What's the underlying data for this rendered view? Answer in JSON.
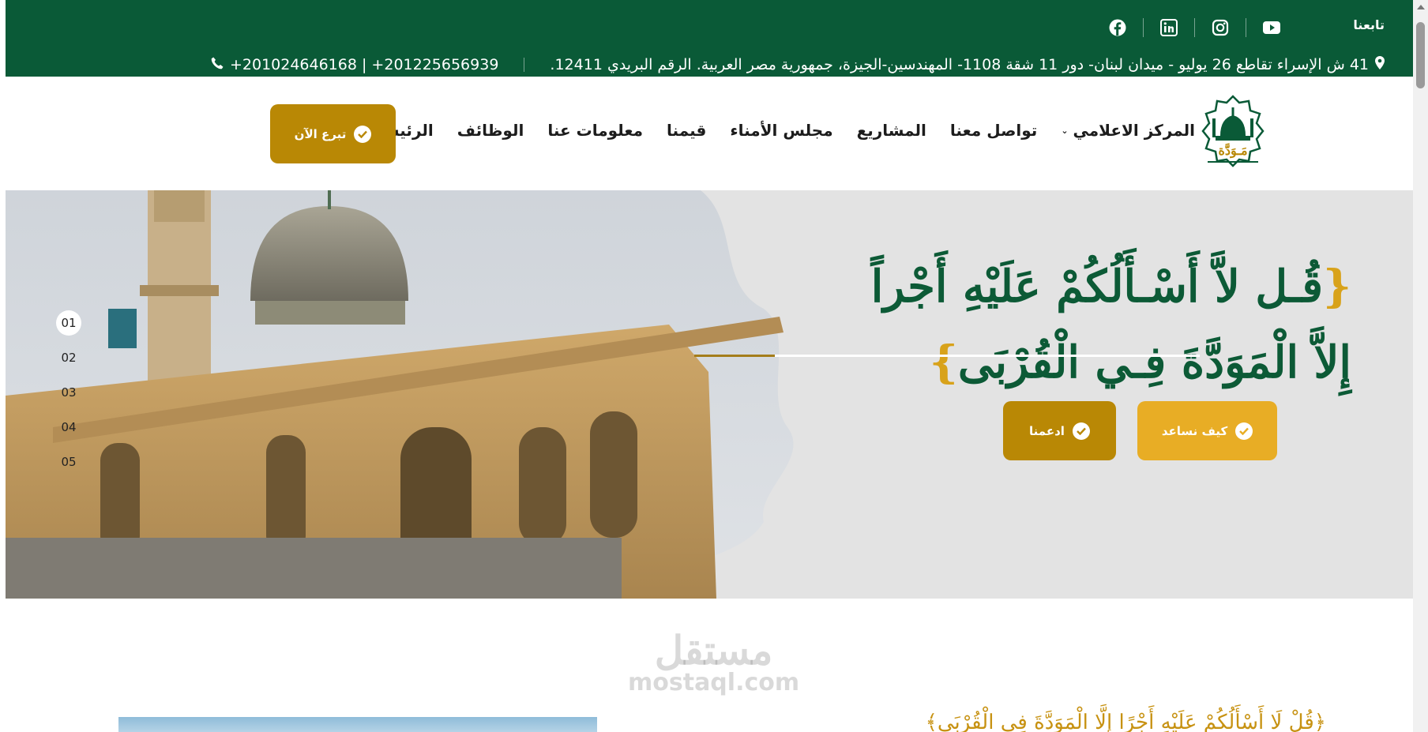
{
  "topbar": {
    "follow_label": "تابعنا",
    "socials": [
      "youtube-icon",
      "instagram-icon",
      "linkedin-icon",
      "facebook-icon"
    ],
    "address": "41 ش الإسراء تقاطع 26 يوليو - ميدان لبنان- دور 11 شقة 1108- المهندسين-الجيزة، جمهورية مصر العربية. الرقم البريدي 12411.",
    "phones": "+201024646168 | +201225656939"
  },
  "header": {
    "logo_alt": "مَـوَدَّة",
    "nav": [
      {
        "label": "الرئيسية"
      },
      {
        "label": "الوظائف"
      },
      {
        "label": "معلومات عنا"
      },
      {
        "label": "قيمنا"
      },
      {
        "label": "مجلس الأمناء"
      },
      {
        "label": "المشاريع"
      },
      {
        "label": "تواصل معنا"
      },
      {
        "label": "المركز الاعلامي",
        "dropdown": true
      }
    ],
    "donate_label": "تبرع الآن"
  },
  "hero": {
    "slides": [
      "01",
      "02",
      "03",
      "04",
      "05"
    ],
    "active_slide": "01",
    "title_line1": "قُـل لاَّ أَسْـأَلُكُمْ عَلَيْهِ أَجْراً",
    "title_line2": "إِلاَّ الْمَوَدَّةَ فِـي الْقُرْبَى",
    "open_bracket": "{",
    "close_bracket": "}",
    "help_label": "كيف نساعد",
    "support_label": "ادعمنا",
    "progress": 0.16
  },
  "below": {
    "watermark_ar": "مستقل",
    "watermark_lat": "mostaql.com",
    "verse": "﴿قُلْ لَا أَسْأَلُكُمْ عَلَيْهِ أَجْرًا إِلَّا الْمَوَدَّةَ فِي الْقُرْبَى﴾"
  },
  "colors": {
    "topbar_bg": "#0a5a37",
    "gold_dark": "#b98805",
    "gold_light": "#e8ad25",
    "title_green": "#0c5a36"
  }
}
